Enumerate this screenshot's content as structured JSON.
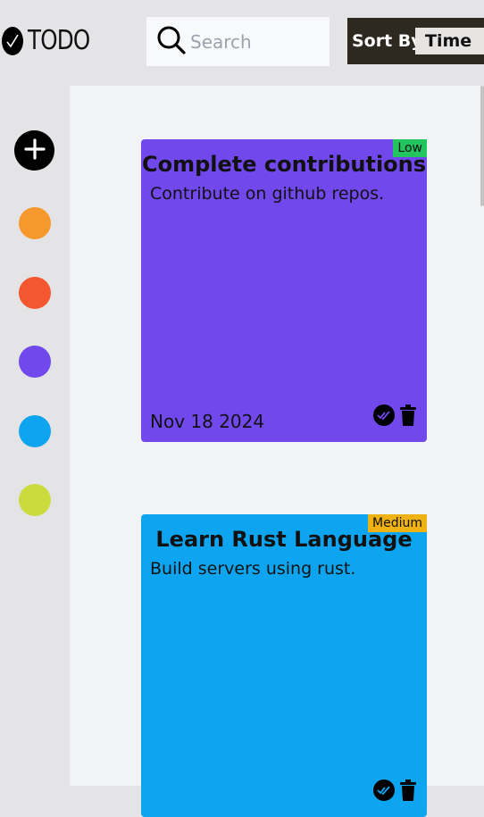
{
  "app": {
    "title": "TODO",
    "logo_icon": "check-circle-icon"
  },
  "search": {
    "placeholder": "Search",
    "value": "",
    "icon": "search-icon"
  },
  "sort": {
    "label": "Sort By",
    "selected": "Time"
  },
  "sidebar": {
    "add_icon": "plus-circle-icon",
    "colors": [
      "#f6982c",
      "#f45630",
      "#7048ec",
      "#0da5f0",
      "#cbdb3e"
    ]
  },
  "notes": [
    {
      "title": "Complete contributions",
      "description": "Contribute on github repos.",
      "priority": "Low",
      "priority_color": "#22c55e",
      "date": "Nov 18 2024",
      "color": "#7048ec"
    },
    {
      "title": "Learn Rust Language",
      "description": "Build servers using rust.",
      "priority": "Medium",
      "priority_color": "#f0b212",
      "date": "",
      "color": "#0da5f0"
    }
  ]
}
